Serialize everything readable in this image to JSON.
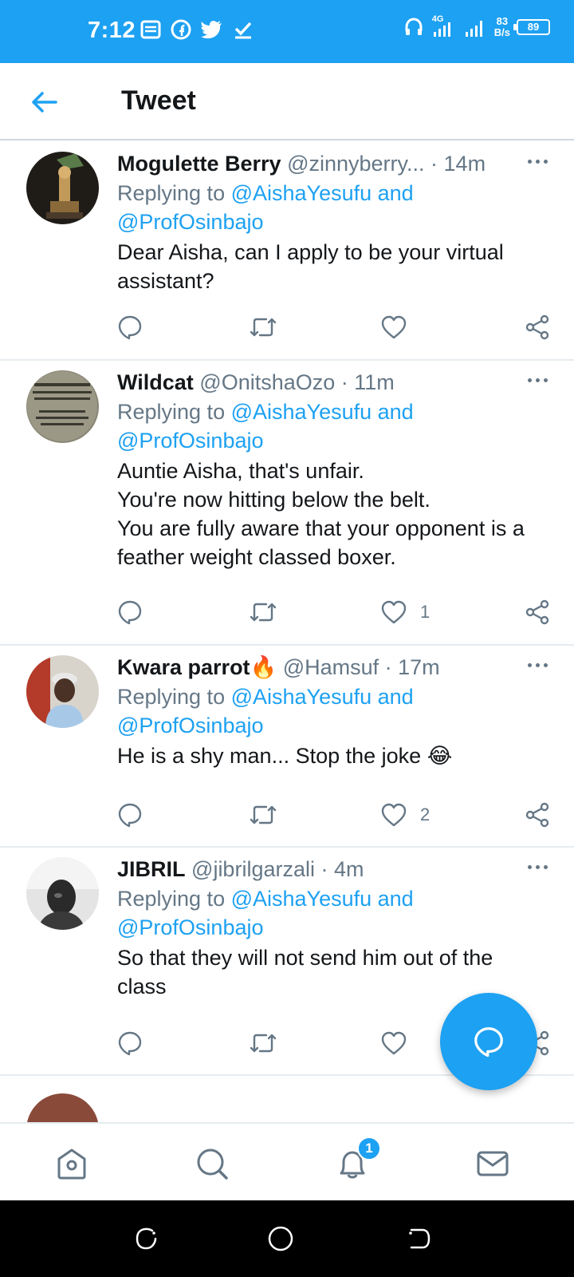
{
  "status_bar": {
    "time": "7:12",
    "network": "4G",
    "speed_value": "83",
    "speed_unit": "B/s",
    "battery": "89"
  },
  "header": {
    "title": "Tweet"
  },
  "tweets": [
    {
      "name": "Mogulette Berry",
      "handle": "@zinnyberry...",
      "time": "· 14m",
      "replying_prefix": "Replying to ",
      "reply_mention_1": "@AishaYesufu and",
      "reply_mention_2": "@ProfOsinbajo",
      "text": "Dear Aisha, can I apply to be your virtual assistant?",
      "like_count": ""
    },
    {
      "name": "Wildcat",
      "handle": "@OnitshaOzo",
      "time": "· 11m",
      "replying_prefix": "Replying to ",
      "reply_mention_1": "@AishaYesufu and",
      "reply_mention_2": "@ProfOsinbajo",
      "text_lines": [
        "Auntie Aisha, that's unfair.",
        "You're now hitting below the belt.",
        "You are fully aware that your opponent is a feather weight classed boxer."
      ],
      "like_count": "1"
    },
    {
      "name": "Kwara parrot🔥",
      "handle": "@Hamsuf",
      "time": "· 17m",
      "replying_prefix": "Replying to ",
      "reply_mention_1": "@AishaYesufu and",
      "reply_mention_2": "@ProfOsinbajo",
      "text": "He is a shy man... Stop the joke 😂",
      "like_count": "2"
    },
    {
      "name": "JIBRIL",
      "handle": "@jibrilgarzali",
      "time": "· 4m",
      "replying_prefix": "Replying to ",
      "reply_mention_1": "@AishaYesufu and",
      "reply_mention_2": "@ProfOsinbajo",
      "text": "So that they will not send him out of the class",
      "like_count": ""
    }
  ],
  "bottom_nav": {
    "notification_count": "1",
    "items": [
      "home-icon",
      "search-icon",
      "bell-icon",
      "mail-icon"
    ]
  },
  "colors": {
    "accent": "#1da1f2",
    "text": "#14171a",
    "muted": "#657786",
    "divider": "#e6ecf0"
  }
}
